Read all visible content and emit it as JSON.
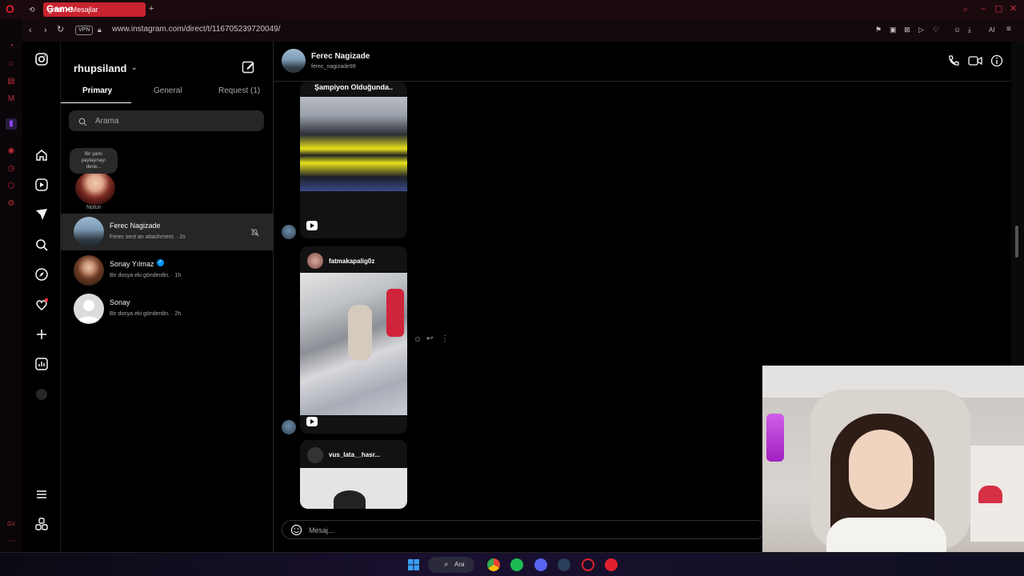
{
  "browser": {
    "tab_title": "gram • Mesajlar",
    "tab_overlay": "Game",
    "url": "www.instagram.com/direct/t/116705239720049/",
    "vpn_label": "VPN",
    "ai_label": "AI"
  },
  "sidebar_list": {
    "account_name": "rhupsiland",
    "tabs": [
      {
        "label": "Primary"
      },
      {
        "label": "General"
      },
      {
        "label": "Request (1)"
      }
    ],
    "search_placeholder": "Arama",
    "note": {
      "bubble_text": "Bir şarkı paylaşmayı dene...",
      "label": "Notun"
    },
    "conversations": [
      {
        "name": "Ferec Nagizade",
        "preview": "Ferec sent an attachment. · 2s",
        "muted": true,
        "selected": true
      },
      {
        "name": "Sonay Yılmaz",
        "preview": "Bir dosya eki gönderdin. · 1h",
        "verified": true
      },
      {
        "name": "Sonay",
        "preview": "Bir dosya eki gönderdin. · 2h"
      }
    ]
  },
  "chat": {
    "contact_name": "Ferec Nagizade",
    "contact_handle": "ferec_nagizade99",
    "messages": [
      {
        "caption": "Şampiyon Olduğunda..",
        "username": ""
      },
      {
        "caption": "",
        "username": "fatmakapalig0z"
      },
      {
        "caption": "",
        "username": "vus_lata__hasr..."
      }
    ],
    "composer_placeholder": "Mesaj..."
  },
  "taskbar": {
    "search_label": "Ara"
  },
  "colors": {
    "accent": "#0095f6",
    "opera_red": "#c8232f",
    "selected_row": "#262626"
  }
}
